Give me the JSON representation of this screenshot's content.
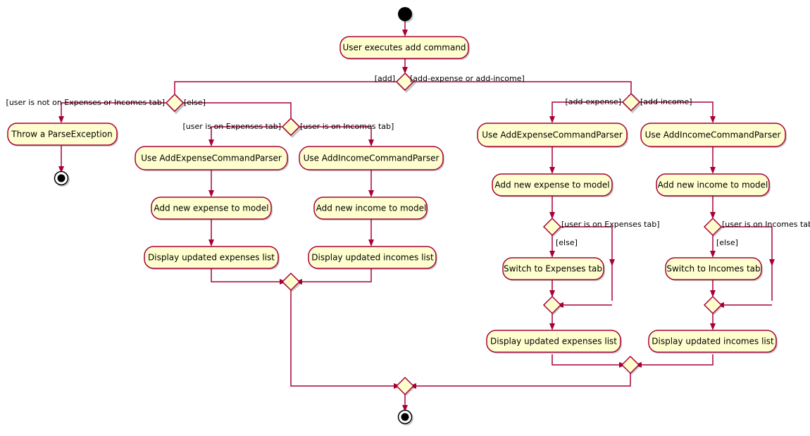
{
  "diagram": {
    "type": "uml-activity-diagram",
    "colors": {
      "node_fill": "#FEFECE",
      "node_border": "#A80036",
      "edge": "#A80036",
      "text": "#000000",
      "background": "#FFFFFF"
    },
    "start_node": "start",
    "nodes": [
      {
        "id": "start",
        "kind": "start",
        "label": ""
      },
      {
        "id": "n_user_exec",
        "kind": "action",
        "label": "User executes add command"
      },
      {
        "id": "d_command",
        "kind": "decision",
        "label": ""
      },
      {
        "id": "d_tab",
        "kind": "decision",
        "label": ""
      },
      {
        "id": "n_throw",
        "kind": "action",
        "label": "Throw a ParseException"
      },
      {
        "id": "end_throw",
        "kind": "end",
        "label": ""
      },
      {
        "id": "d_which_tab",
        "kind": "decision",
        "label": ""
      },
      {
        "id": "n_use_exp_parser_mid",
        "kind": "action",
        "label": "Use AddExpenseCommandParser"
      },
      {
        "id": "n_add_exp_mid",
        "kind": "action",
        "label": "Add new expense to model"
      },
      {
        "id": "n_disp_exp_mid",
        "kind": "action",
        "label": "Display updated expenses list"
      },
      {
        "id": "n_use_inc_parser_mid",
        "kind": "action",
        "label": "Use AddIncomeCommandParser"
      },
      {
        "id": "n_add_inc_mid",
        "kind": "action",
        "label": "Add new income to model"
      },
      {
        "id": "n_disp_inc_mid",
        "kind": "action",
        "label": "Display updated incomes list"
      },
      {
        "id": "m_mid",
        "kind": "merge",
        "label": ""
      },
      {
        "id": "d_exp_or_inc",
        "kind": "decision",
        "label": ""
      },
      {
        "id": "n_use_exp_parser_rt",
        "kind": "action",
        "label": "Use AddExpenseCommandParser"
      },
      {
        "id": "n_add_exp_rt",
        "kind": "action",
        "label": "Add new expense to model"
      },
      {
        "id": "d_on_exp_tab",
        "kind": "decision",
        "label": ""
      },
      {
        "id": "n_switch_exp",
        "kind": "action",
        "label": "Switch to Expenses tab"
      },
      {
        "id": "m_exp",
        "kind": "merge",
        "label": ""
      },
      {
        "id": "n_disp_exp_rt",
        "kind": "action",
        "label": "Display updated expenses list"
      },
      {
        "id": "n_use_inc_parser_rt",
        "kind": "action",
        "label": "Use AddIncomeCommandParser"
      },
      {
        "id": "n_add_inc_rt",
        "kind": "action",
        "label": "Add new income to model"
      },
      {
        "id": "d_on_inc_tab",
        "kind": "decision",
        "label": ""
      },
      {
        "id": "n_switch_inc",
        "kind": "action",
        "label": "Switch to Incomes tab"
      },
      {
        "id": "m_inc",
        "kind": "merge",
        "label": ""
      },
      {
        "id": "n_disp_inc_rt",
        "kind": "action",
        "label": "Display updated incomes list"
      },
      {
        "id": "m_right",
        "kind": "merge",
        "label": ""
      },
      {
        "id": "m_final",
        "kind": "merge",
        "label": ""
      },
      {
        "id": "end_final",
        "kind": "end",
        "label": ""
      }
    ],
    "guards": {
      "add": "[add]",
      "add_expense_or_add_income": "[add-expense or add-income]",
      "not_on_tab": "[user is not on Expenses or Incomes tab]",
      "else_top": "[else]",
      "on_expenses_tab_mid": "[user is on Expenses tab]",
      "on_incomes_tab_mid": "[user is on Incomes tab]",
      "add_expense": "[add-expense]",
      "add_income": "[add-income]",
      "on_expenses_tab_rt": "[user is on Expenses tab]",
      "else_exp": "[else]",
      "on_incomes_tab_rt": "[user is on Incomes tab]",
      "else_inc": "[else]"
    },
    "labels": {
      "user_executes_add_command": "User executes add command",
      "throw_parse_exception": "Throw a ParseException",
      "use_add_expense_command_parser": "Use AddExpenseCommandParser",
      "use_add_income_command_parser": "Use AddIncomeCommandParser",
      "add_new_expense_to_model": "Add new expense to model",
      "add_new_income_to_model": "Add new income to model",
      "display_updated_expenses_list": "Display updated expenses list",
      "display_updated_incomes_list": "Display updated incomes list",
      "switch_to_expenses_tab": "Switch to Expenses tab",
      "switch_to_incomes_tab": "Switch to Incomes tab"
    }
  }
}
